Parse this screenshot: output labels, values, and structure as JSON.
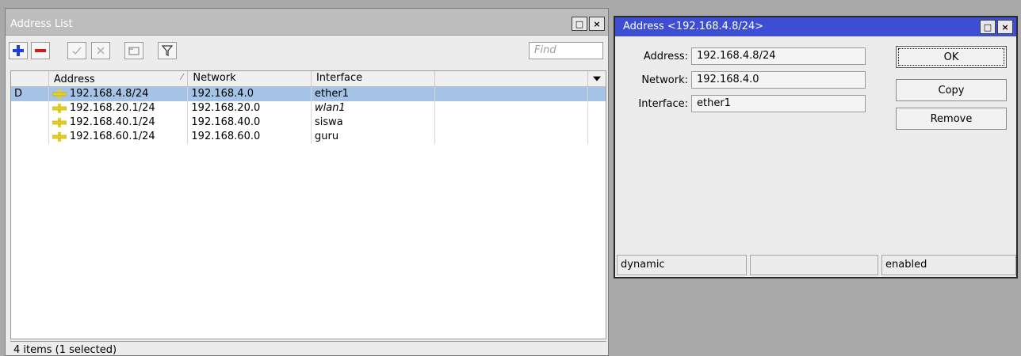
{
  "address_list_window": {
    "title": "Address List",
    "title_buttons": [
      "□",
      "×"
    ],
    "toolbar": {
      "add_icon": "plus-icon",
      "remove_icon": "minus-icon",
      "enable_icon": "check-icon",
      "disable_icon": "cross-icon",
      "comment_icon": "comment-icon",
      "filter_icon": "filter-icon",
      "find_placeholder": "Find"
    },
    "columns": [
      "",
      "Address",
      "Network",
      "Interface",
      ""
    ],
    "rows": [
      {
        "flag": "D",
        "address": "192.168.4.8/24",
        "network": "192.168.4.0",
        "interface": "ether1",
        "selected": true,
        "italic_interface": false
      },
      {
        "flag": "",
        "address": "192.168.20.1/24",
        "network": "192.168.20.0",
        "interface": "wlan1",
        "selected": false,
        "italic_interface": true
      },
      {
        "flag": "",
        "address": "192.168.40.1/24",
        "network": "192.168.40.0",
        "interface": "siswa",
        "selected": false,
        "italic_interface": false
      },
      {
        "flag": "",
        "address": "192.168.60.1/24",
        "network": "192.168.60.0",
        "interface": "guru",
        "selected": false,
        "italic_interface": false
      }
    ],
    "status": "4 items (1 selected)"
  },
  "address_dialog": {
    "title": "Address <192.168.4.8/24>",
    "title_buttons": [
      "□",
      "×"
    ],
    "fields": {
      "address_label": "Address:",
      "address_value": "192.168.4.8/24",
      "network_label": "Network:",
      "network_value": "192.168.4.0",
      "interface_label": "Interface:",
      "interface_value": "ether1"
    },
    "buttons": {
      "ok": "OK",
      "copy": "Copy",
      "remove": "Remove"
    },
    "status": [
      "dynamic",
      "",
      "enabled"
    ]
  },
  "colors": {
    "selected_row": "#a5c3e6",
    "dialog_title": "#3d4dd4",
    "address_icon": "#e8d020",
    "add_blue": "#1f3fd8",
    "remove_red": "#d41a1a"
  }
}
